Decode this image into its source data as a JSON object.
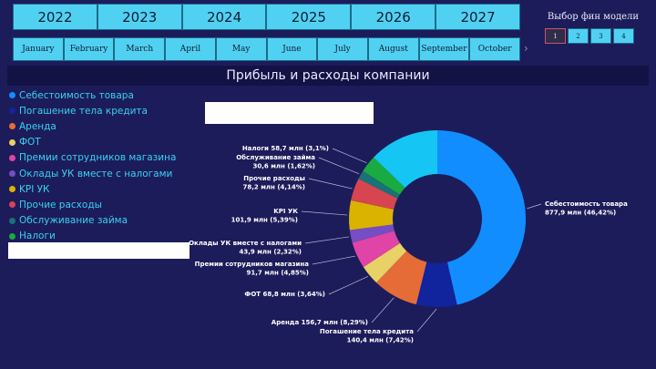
{
  "years": [
    "2022",
    "2023",
    "2024",
    "2025",
    "2026",
    "2027"
  ],
  "months": [
    "January",
    "February",
    "March",
    "April",
    "May",
    "June",
    "July",
    "August",
    "September",
    "October"
  ],
  "month_scroll_icon": "chevron-right-icon",
  "model_selector": {
    "title": "Выбор фин модели",
    "options": [
      "1",
      "2",
      "3",
      "4"
    ],
    "selected": "1"
  },
  "chart_title": "Прибыль и расходы компании",
  "colors": {
    "background": "#1d1c5a",
    "tile": "#51d1f2",
    "banner": "#121244",
    "legend_text": "#38d1f2"
  },
  "chart_data": {
    "type": "pie",
    "variant": "donut",
    "title": "Прибыль и расходы компании",
    "unit": "млн",
    "legend_position": "left",
    "slices": [
      {
        "name": "Себестоимость товара",
        "value": 877.9,
        "percent": "46,42%",
        "label": "Себестоимость товара",
        "sublabel": "877,9 млн (46,42%)",
        "color": "#118dff"
      },
      {
        "name": "Погашение тела кредита",
        "value": 140.4,
        "percent": "7,42%",
        "label": "Погашение тела кредита",
        "sublabel": "140,4 млн (7,42%)",
        "color": "#12239e"
      },
      {
        "name": "Аренда",
        "value": 156.7,
        "percent": "8,29%",
        "label": "Аренда 156,7 млн (8,29%)",
        "sublabel": "",
        "color": "#e66c37"
      },
      {
        "name": "ФОТ",
        "value": 68.8,
        "percent": "3,64%",
        "label": "ФОТ 68,8 млн (3,64%)",
        "sublabel": "",
        "color": "#e8d166"
      },
      {
        "name": "Премии сотрудников магазина",
        "value": 91.7,
        "percent": "4,85%",
        "label": "Премии сотрудников магазина",
        "sublabel": "91,7 млн (4,85%)",
        "color": "#e044a7"
      },
      {
        "name": "Оклады УК вместе с налогами",
        "value": 43.9,
        "percent": "2,32%",
        "label": "Оклады УК вместе с налогами",
        "sublabel": "43,9 млн (2,32%)",
        "color": "#744ec2"
      },
      {
        "name": "KPI УК",
        "value": 101.9,
        "percent": "5,39%",
        "label": "KPI УК",
        "sublabel": "101,9 млн (5,39%)",
        "color": "#d9b300"
      },
      {
        "name": "Прочие расходы",
        "value": 78.2,
        "percent": "4,14%",
        "label": "Прочие расходы",
        "sublabel": "78,2 млн (4,14%)",
        "color": "#d64550"
      },
      {
        "name": "Обслуживание займа",
        "value": 30.6,
        "percent": "1,62%",
        "label": "Обслуживание займа",
        "sublabel": "30,6 млн (1,62%)",
        "color": "#197278"
      },
      {
        "name": "Налоги",
        "value": 58.7,
        "percent": "3,1%",
        "label": "Налоги 58,7 млн (3,1%)",
        "sublabel": "",
        "color": "#1aab40"
      },
      {
        "name": "",
        "value": 242.4,
        "percent": "",
        "label": "",
        "sublabel": "",
        "color": "#15c6f4"
      }
    ]
  }
}
